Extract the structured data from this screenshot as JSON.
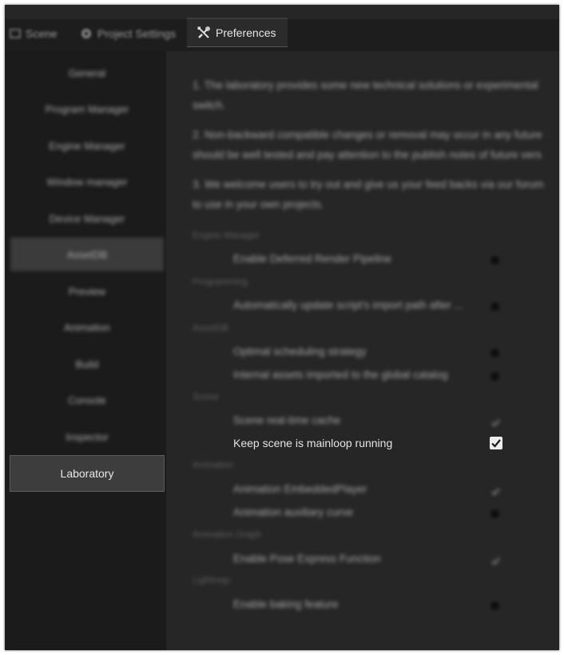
{
  "tabs": [
    {
      "label": "Scene",
      "icon": "scene-icon"
    },
    {
      "label": "Project Settings",
      "icon": "gear-icon"
    },
    {
      "label": "Preferences",
      "icon": "tools-icon"
    }
  ],
  "sidebar": {
    "items": [
      {
        "label": "General"
      },
      {
        "label": "Program Manager"
      },
      {
        "label": "Engine Manager"
      },
      {
        "label": "Window manager"
      },
      {
        "label": "Device Manager"
      },
      {
        "label": "AssetDB"
      },
      {
        "label": "Preview"
      },
      {
        "label": "Animation"
      },
      {
        "label": "Build"
      },
      {
        "label": "Console"
      },
      {
        "label": "Inspector"
      },
      {
        "label": "Laboratory"
      }
    ]
  },
  "intro": {
    "p1_line1": "1. The laboratory provides some new technical solutions or experimental",
    "p1_line2": "switch.",
    "p2_line1": "2. Non-backward compatible changes or removal may occur in any future",
    "p2_line2": "should be well tested and pay attention to the publish notes of future vers",
    "p3_line1": "3. We welcome users to try out and give us your feed backs via our forum",
    "p3_line2": "to use in your own projects."
  },
  "groups": {
    "engine_manager": "Engine Manager",
    "programming": "Programming",
    "assetdb": "AssetDB",
    "scene": "Scene",
    "animation": "Animation",
    "animation_graph": "Animation Graph",
    "lightmap": "Lightmap"
  },
  "options": {
    "deferred_pipeline": {
      "label": "Enable Deferred Render Pipeline",
      "checked": false
    },
    "auto_update_import": {
      "label": "Automatically update script's import path after ...",
      "checked": false
    },
    "optimal_scheduling": {
      "label": "Optimal scheduling strategy",
      "checked": false
    },
    "internal_assets_catalog": {
      "label": "Internal assets imported to the global catalog",
      "checked": false
    },
    "scene_realtime_cache": {
      "label": "Scene real-time cache",
      "checked": true
    },
    "keep_scene_mainloop": {
      "label": "Keep scene is mainloop running",
      "checked": true
    },
    "animation_embedded_player": {
      "label": "Animation EmbeddedPlayer",
      "checked": true
    },
    "animation_auxiliary_curve": {
      "label": "Animation auxiliary curve",
      "checked": false
    },
    "pose_express_function": {
      "label": "Enable Pose Express Function",
      "checked": true
    },
    "baking_feature": {
      "label": "Enable baking feature",
      "checked": false
    }
  }
}
